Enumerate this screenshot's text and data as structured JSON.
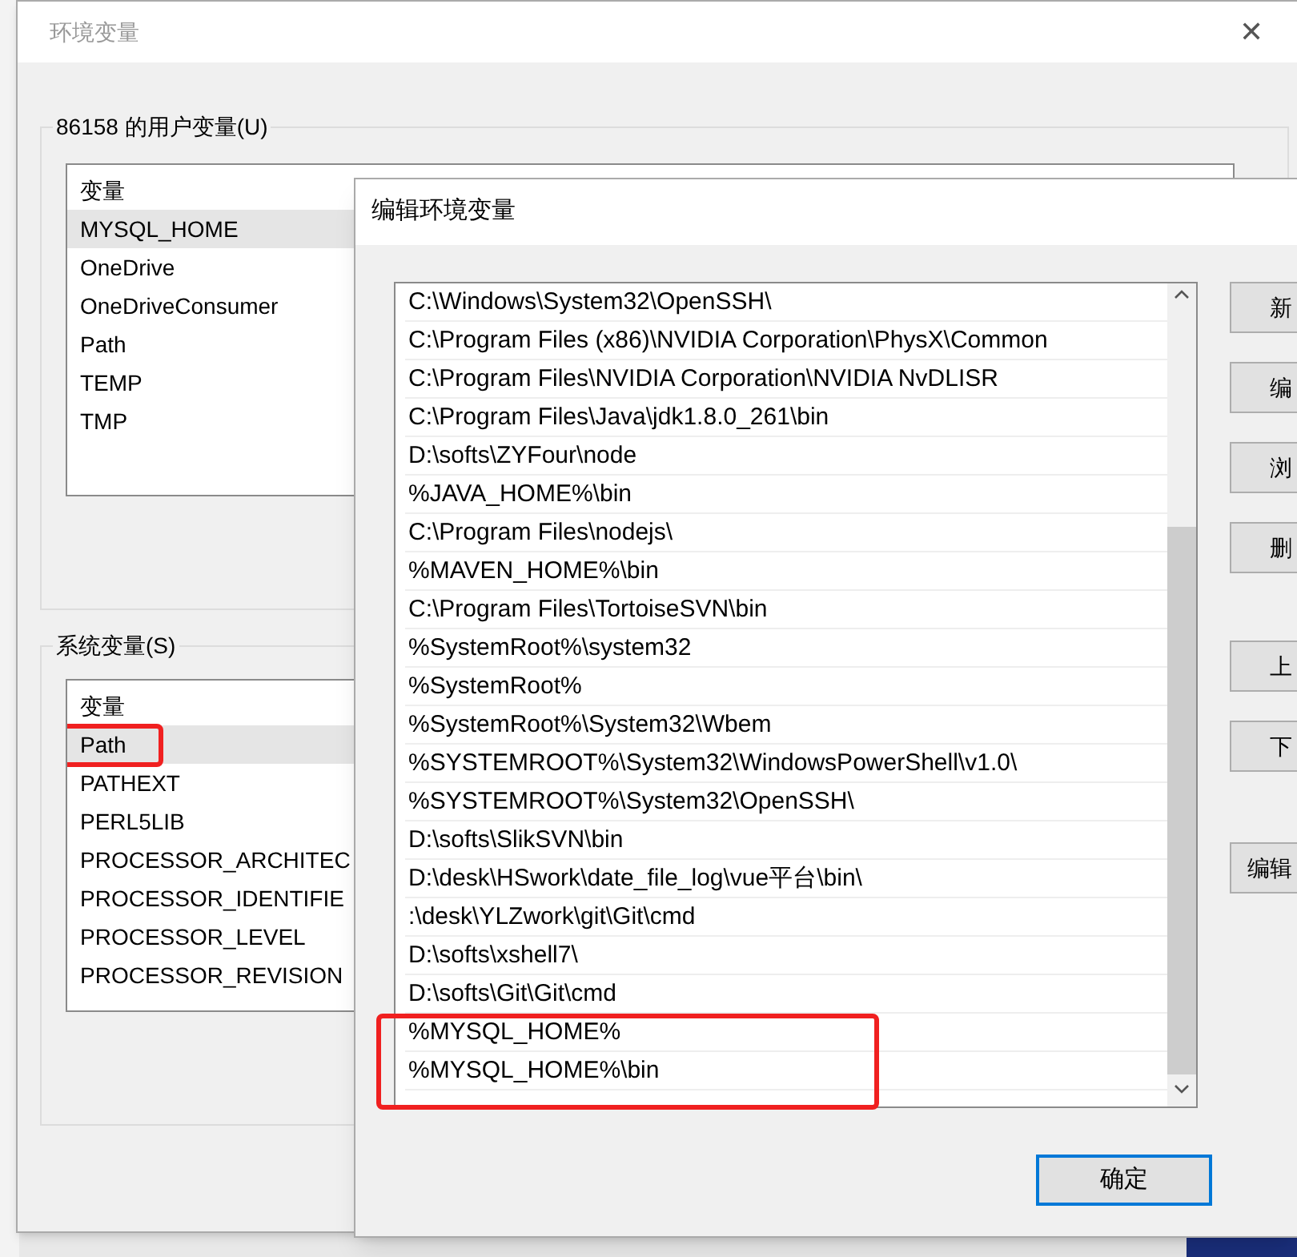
{
  "main_window": {
    "title": "环境变量",
    "close": "✕",
    "user_vars": {
      "legend": "86158 的用户变量(U)",
      "column_1": "变量",
      "rows": [
        {
          "name": "MYSQL_HOME",
          "selected": true,
          "annotated": false
        },
        {
          "name": "OneDrive",
          "selected": false,
          "annotated": false
        },
        {
          "name": "OneDriveConsumer",
          "selected": false,
          "annotated": false
        },
        {
          "name": "Path",
          "selected": false,
          "annotated": false
        },
        {
          "name": "TEMP",
          "selected": false,
          "annotated": false
        },
        {
          "name": "TMP",
          "selected": false,
          "annotated": false
        }
      ]
    },
    "system_vars": {
      "legend": "系统变量(S)",
      "column_1": "变量",
      "rows": [
        {
          "name": "Path",
          "selected": true,
          "annotated": true
        },
        {
          "name": "PATHEXT",
          "selected": false,
          "annotated": false
        },
        {
          "name": "PERL5LIB",
          "selected": false,
          "annotated": false
        },
        {
          "name": "PROCESSOR_ARCHITEC",
          "selected": false,
          "annotated": false
        },
        {
          "name": "PROCESSOR_IDENTIFIE",
          "selected": false,
          "annotated": false
        },
        {
          "name": "PROCESSOR_LEVEL",
          "selected": false,
          "annotated": false
        },
        {
          "name": "PROCESSOR_REVISION",
          "selected": false,
          "annotated": false
        }
      ]
    }
  },
  "edit_dialog": {
    "title": "编辑环境变量",
    "entries": [
      {
        "text": "C:\\Windows\\System32\\OpenSSH\\",
        "annotated": false
      },
      {
        "text": "C:\\Program Files (x86)\\NVIDIA Corporation\\PhysX\\Common",
        "annotated": false
      },
      {
        "text": "C:\\Program Files\\NVIDIA Corporation\\NVIDIA NvDLISR",
        "annotated": false
      },
      {
        "text": "C:\\Program Files\\Java\\jdk1.8.0_261\\bin",
        "annotated": false
      },
      {
        "text": "D:\\softs\\ZYFour\\node",
        "annotated": false
      },
      {
        "text": "%JAVA_HOME%\\bin",
        "annotated": false
      },
      {
        "text": "C:\\Program Files\\nodejs\\",
        "annotated": false
      },
      {
        "text": "%MAVEN_HOME%\\bin",
        "annotated": false
      },
      {
        "text": "C:\\Program Files\\TortoiseSVN\\bin",
        "annotated": false
      },
      {
        "text": "%SystemRoot%\\system32",
        "annotated": false
      },
      {
        "text": "%SystemRoot%",
        "annotated": false
      },
      {
        "text": "%SystemRoot%\\System32\\Wbem",
        "annotated": false
      },
      {
        "text": "%SYSTEMROOT%\\System32\\WindowsPowerShell\\v1.0\\",
        "annotated": false
      },
      {
        "text": "%SYSTEMROOT%\\System32\\OpenSSH\\",
        "annotated": false
      },
      {
        "text": "D:\\softs\\SlikSVN\\bin",
        "annotated": false
      },
      {
        "text": "D:\\desk\\HSwork\\date_file_log\\vue平台\\bin\\",
        "annotated": false
      },
      {
        "text": ":\\desk\\YLZwork\\git\\Git\\cmd",
        "annotated": false
      },
      {
        "text": "D:\\softs\\xshell7\\",
        "annotated": false
      },
      {
        "text": "D:\\softs\\Git\\Git\\cmd",
        "annotated": false
      },
      {
        "text": "%MYSQL_HOME%",
        "annotated": true
      },
      {
        "text": "%MYSQL_HOME%\\bin",
        "annotated": true
      }
    ],
    "side_buttons": [
      "新",
      "编",
      "浏",
      "删",
      "上",
      "下",
      "编辑"
    ],
    "ok_button": "确定"
  }
}
